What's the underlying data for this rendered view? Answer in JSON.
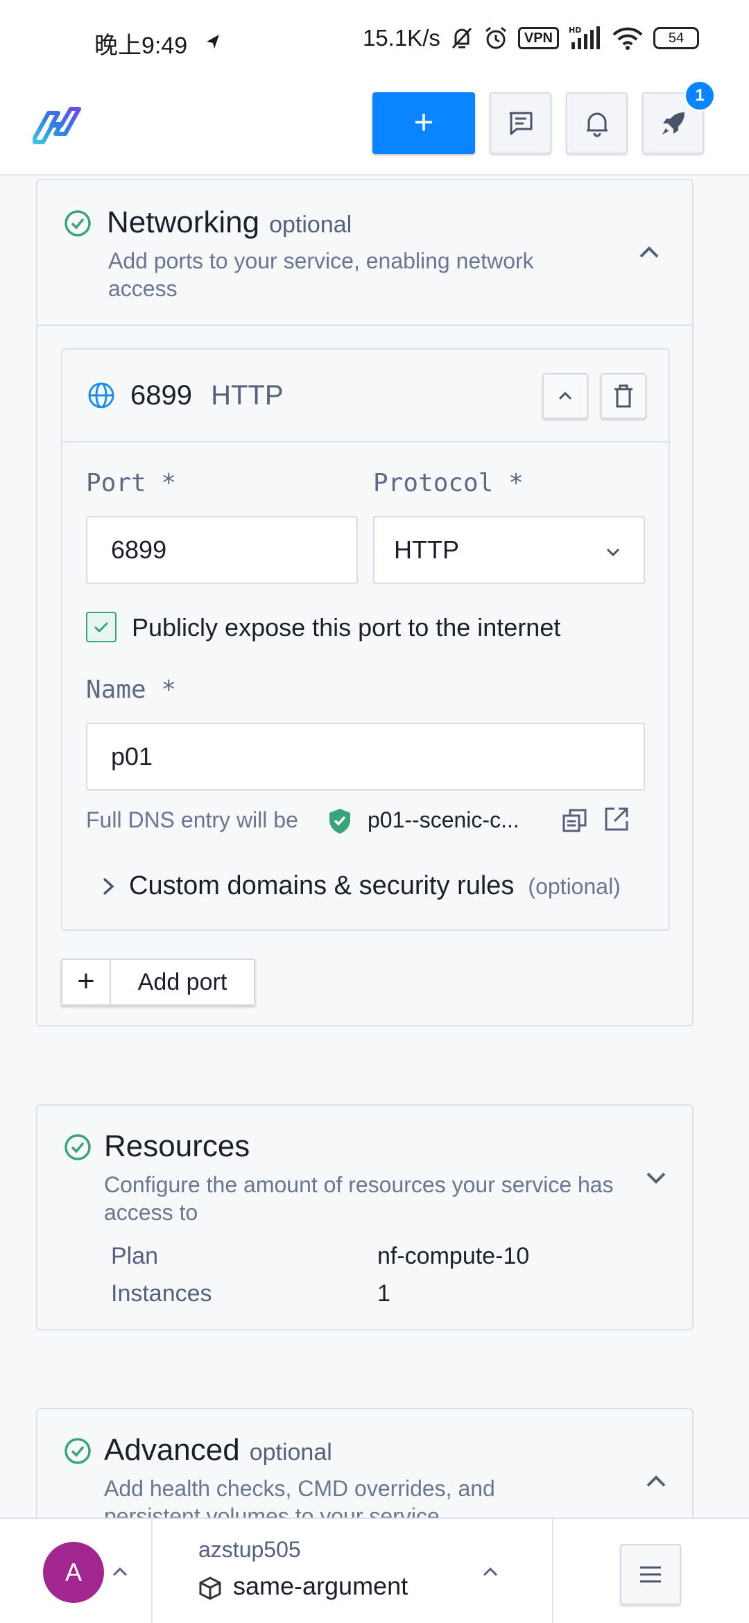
{
  "status_bar": {
    "time": "晚上9:49",
    "net_speed": "15.1K/s",
    "vpn": "VPN",
    "battery": "54"
  },
  "header": {
    "create_label": "+",
    "notification_count": "1",
    "icons": [
      "logo-icon",
      "chat-icon",
      "bell-icon",
      "rocket-icon"
    ]
  },
  "networking": {
    "title": "Networking",
    "optional": "optional",
    "description": "Add ports to your service, enabling network access",
    "port": {
      "number": "6899",
      "protocol": "HTTP",
      "port_label": "Port *",
      "protocol_label": "Protocol *",
      "port_value": "6899",
      "protocol_value": "HTTP",
      "expose_label": "Publicly expose this port to the internet",
      "expose_checked": true,
      "name_label": "Name *",
      "name_value": "p01",
      "dns_prefix": "Full DNS entry will be",
      "dns_value": "p01--scenic-c...",
      "custom_domains": "Custom domains & security rules",
      "custom_optional": "(optional)"
    },
    "add_port_icon": "+",
    "add_port_label": "Add port"
  },
  "resources": {
    "title": "Resources",
    "description": "Configure the amount of resources your service has access to",
    "plan_label": "Plan",
    "plan_value": "nf-compute-10",
    "instances_label": "Instances",
    "instances_value": "1"
  },
  "advanced": {
    "title": "Advanced",
    "optional": "optional",
    "description": "Add health checks, CMD overrides, and persistent volumes to your service"
  },
  "bottom_bar": {
    "avatar_letter": "A",
    "team": "azstup505",
    "project": "same-argument"
  },
  "colors": {
    "accent": "#0a84ff",
    "success": "#3aa37a",
    "avatar": "#a1278f"
  }
}
